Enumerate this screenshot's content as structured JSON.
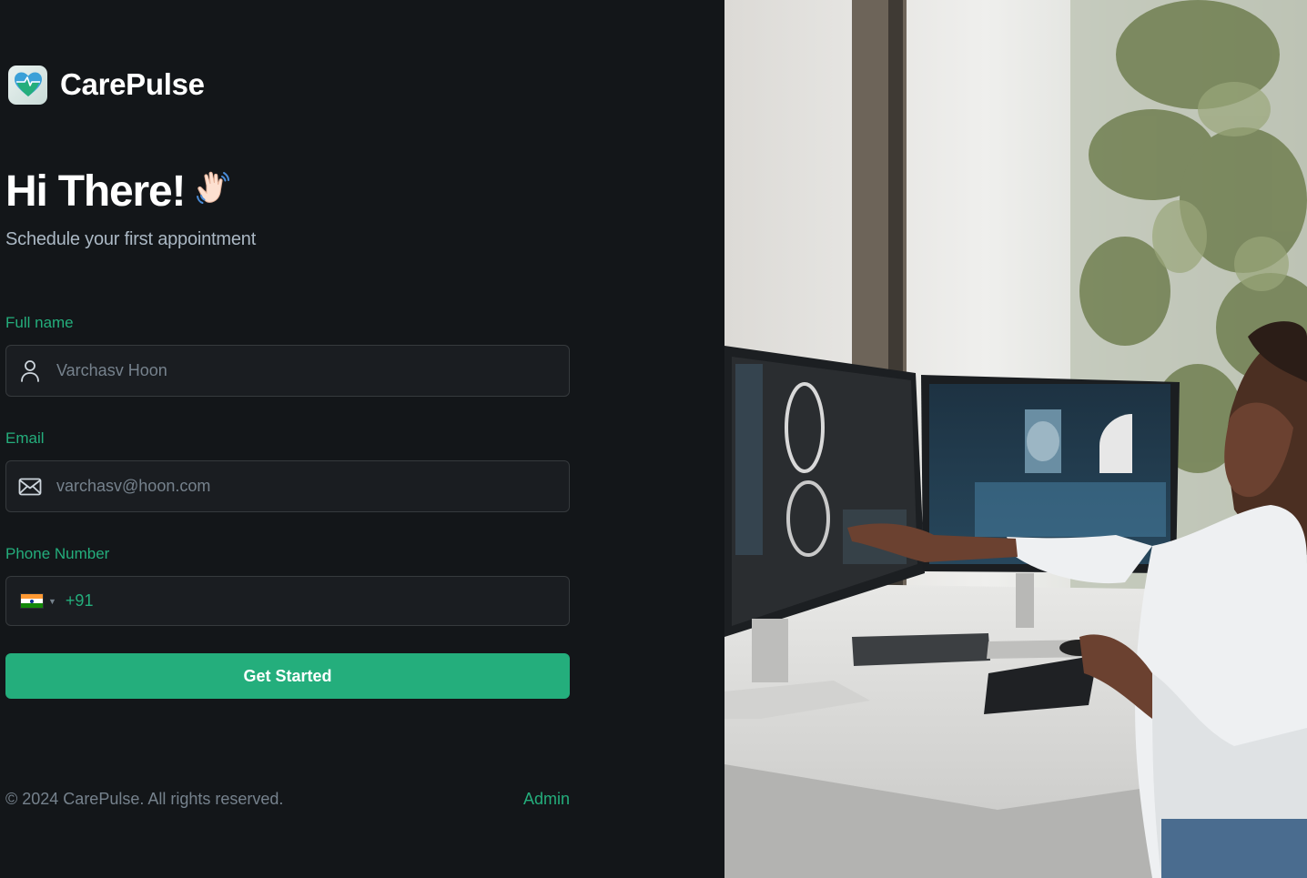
{
  "brand": {
    "name": "CarePulse"
  },
  "hero": {
    "title": "Hi There!",
    "subtitle": "Schedule your first appointment"
  },
  "form": {
    "name": {
      "label": "Full name",
      "placeholder": "Varchasv Hoon"
    },
    "email": {
      "label": "Email",
      "placeholder": "varchasv@hoon.com"
    },
    "phone": {
      "label": "Phone Number",
      "dial_code": "+91",
      "country_flag": "india-flag-icon"
    },
    "submit_label": "Get Started"
  },
  "footer": {
    "copyright": "© 2024 CarePulse. All rights reserved.",
    "admin_link": "Admin"
  },
  "colors": {
    "accent": "#24ae7c",
    "background": "#131619",
    "input_bg": "#1a1d21",
    "muted_text": "#76828d"
  },
  "icons": [
    "carepulse-logo-icon",
    "waving-hand-icon",
    "user-icon",
    "mail-icon",
    "india-flag-icon",
    "chevron-down-icon"
  ]
}
